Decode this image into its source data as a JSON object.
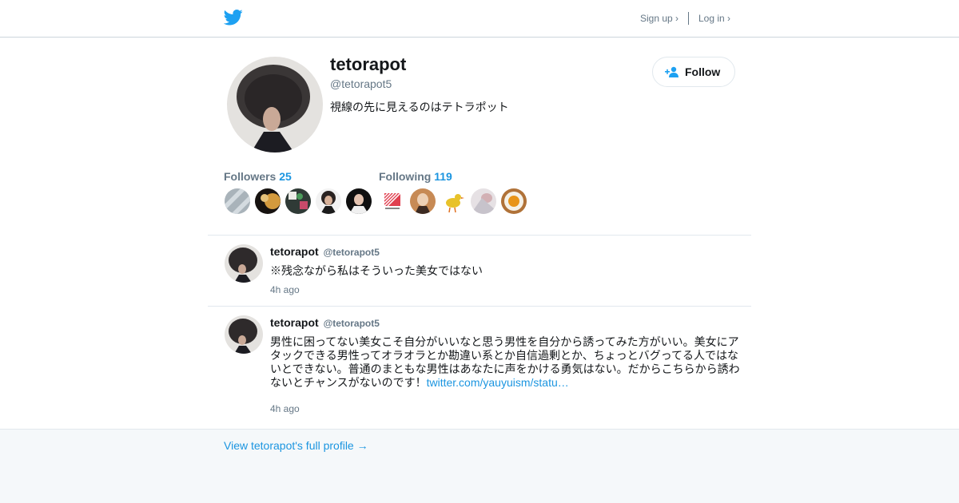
{
  "header": {
    "signup_label": "Sign up ›",
    "login_label": "Log in ›"
  },
  "profile": {
    "name": "tetorapot",
    "handle": "@tetorapot5",
    "bio": "視線の先に見えるのはテトラポット",
    "follow_label": "Follow",
    "followers_label": "Followers",
    "followers_count": "25",
    "following_label": "Following",
    "following_count": "119"
  },
  "tweets": [
    {
      "name": "tetorapot",
      "handle": "@tetorapot5",
      "text": "※残念ながら私はそういった美女ではない",
      "link": "",
      "time": "4h ago"
    },
    {
      "name": "tetorapot",
      "handle": "@tetorapot5",
      "text": "男性に困ってない美女こそ自分がいいなと思う男性を自分から誘ってみた方がいい。美女にアタックできる男性ってオラオラとか勘違い系とか自信過剰とか、ちょっとバグってる人ではないとできない。普通のまともな男性はあなたに声をかける勇気はない。だからこちらから誘わないとチャンスがないのです！",
      "link": "twitter.com/yauyuism/statu…",
      "time": "4h ago"
    }
  ],
  "footer": {
    "full_profile_link": "View tetorapot's full profile →"
  },
  "colors": {
    "brand_blue": "#1da1f2",
    "link_blue": "#1b95e0",
    "muted_gray": "#657786",
    "page_bg": "#f5f8fa"
  },
  "icons": {
    "logo": "twitter-bird-icon",
    "follow": "add-person-icon"
  }
}
